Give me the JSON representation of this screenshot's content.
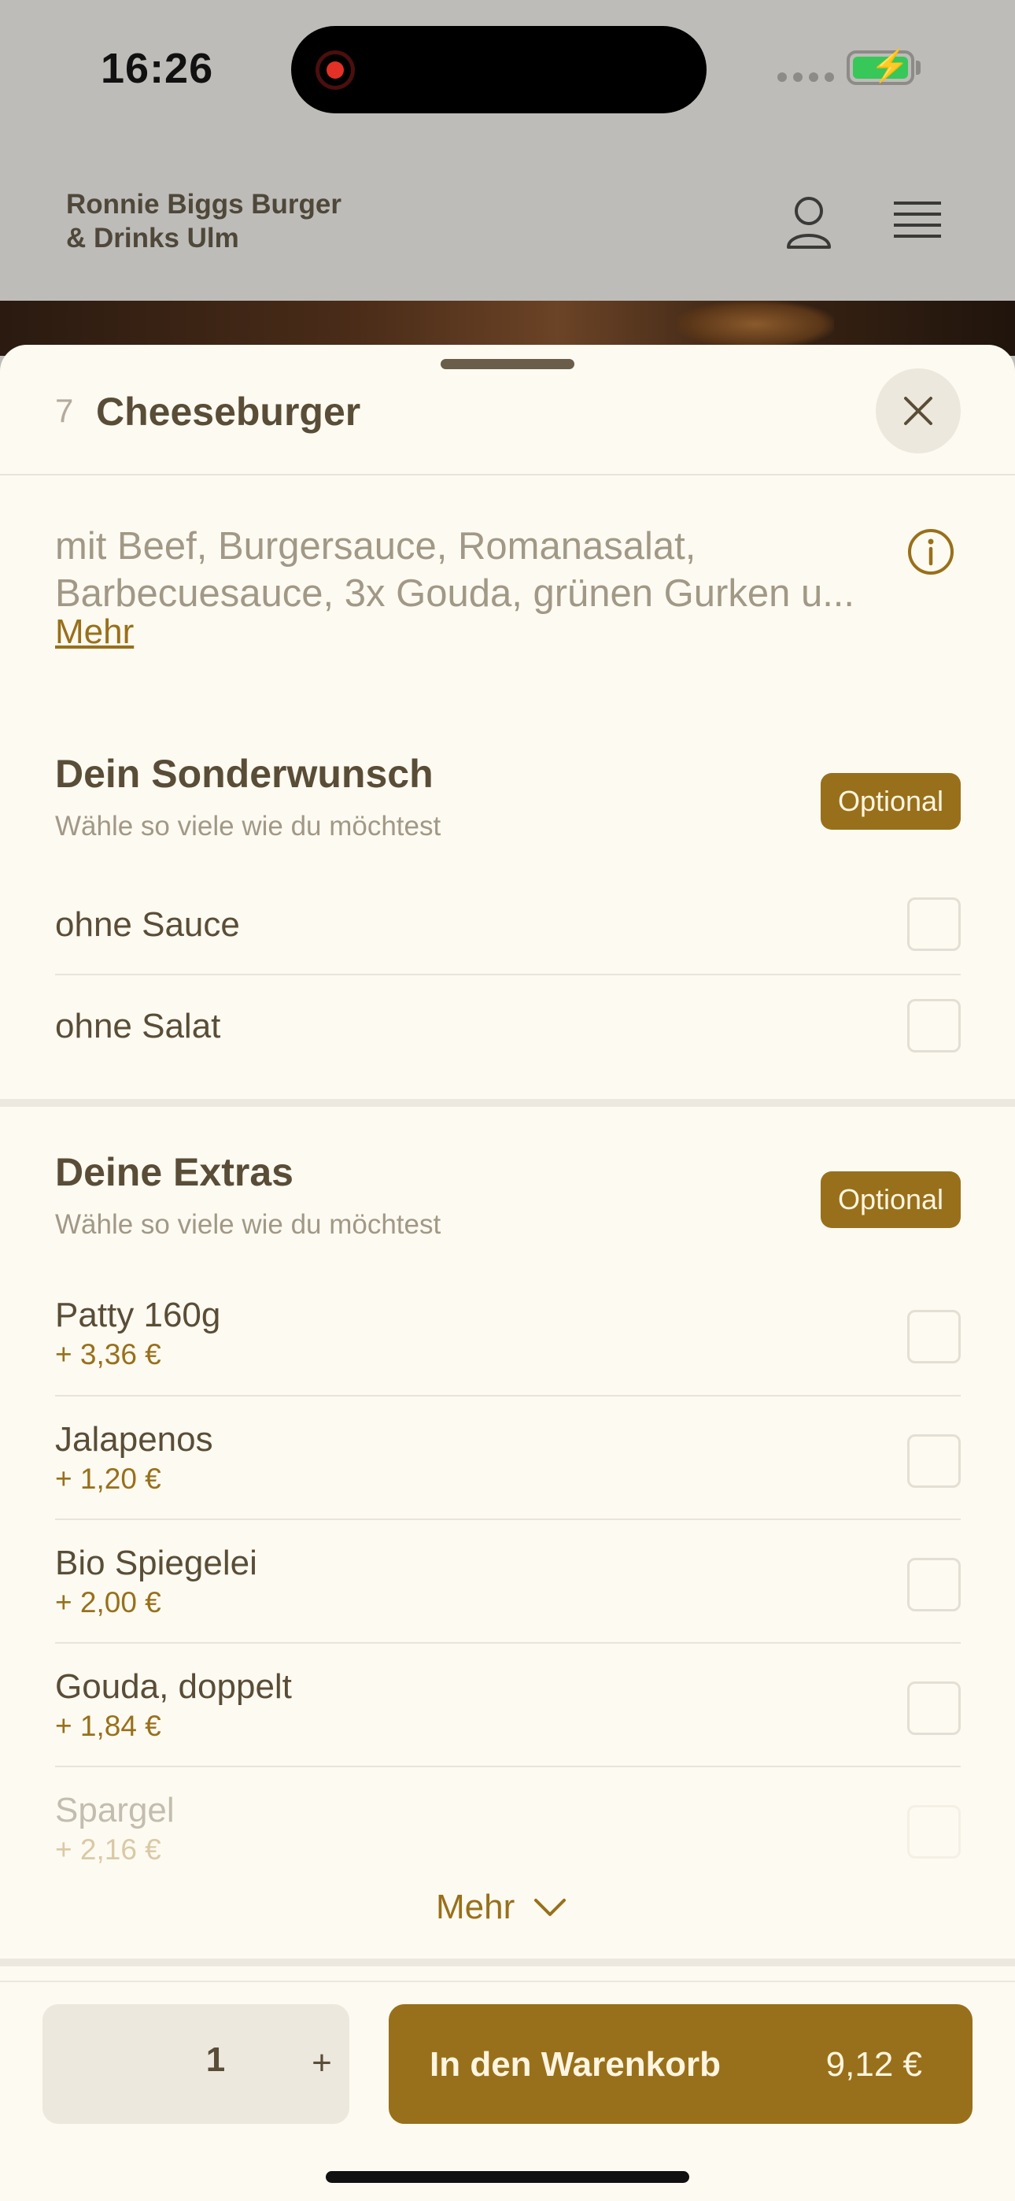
{
  "status_bar": {
    "time": "16:26",
    "battery_charging": true,
    "accent": "#38c759"
  },
  "header": {
    "brand_line1": "Ronnie Biggs Burger",
    "brand_line2": "& Drinks Ulm",
    "icons": [
      "user-icon",
      "hamburger-menu-icon"
    ]
  },
  "item": {
    "number": "7",
    "title": "Cheeseburger",
    "description_line1": "mit Beef, Burgersauce, Romanasalat,",
    "description_line2": "Barbecuesauce, 3x Gouda, grünen Gurken u...",
    "more_label": "Mehr"
  },
  "sections": [
    {
      "title": "Dein Sonderwunsch",
      "subtitle": "Wähle so viele wie du möchtest",
      "badge": "Optional",
      "options": [
        {
          "label": "ohne Sauce"
        },
        {
          "label": "ohne Salat"
        }
      ]
    },
    {
      "title": "Deine Extras",
      "subtitle": "Wähle so viele wie du möchtest",
      "badge": "Optional",
      "options": [
        {
          "label": "Patty 160g",
          "price": "+ 3,36 €"
        },
        {
          "label": "Jalapenos",
          "price": "+ 1,20 €"
        },
        {
          "label": "Bio Spiegelei",
          "price": "+ 2,00 €"
        },
        {
          "label": "Gouda, doppelt",
          "price": "+ 1,84 €"
        },
        {
          "label": "Spargel",
          "price": "+ 2,16 €"
        }
      ],
      "more_label": "Mehr"
    }
  ],
  "footer": {
    "quantity": "1",
    "plus_label": "+",
    "add_label": "In den Warenkorb",
    "total": "9,12 €"
  },
  "colors": {
    "brand": "#98701b",
    "sheet_bg": "#fdfaf1",
    "text": "#5a4d37"
  }
}
